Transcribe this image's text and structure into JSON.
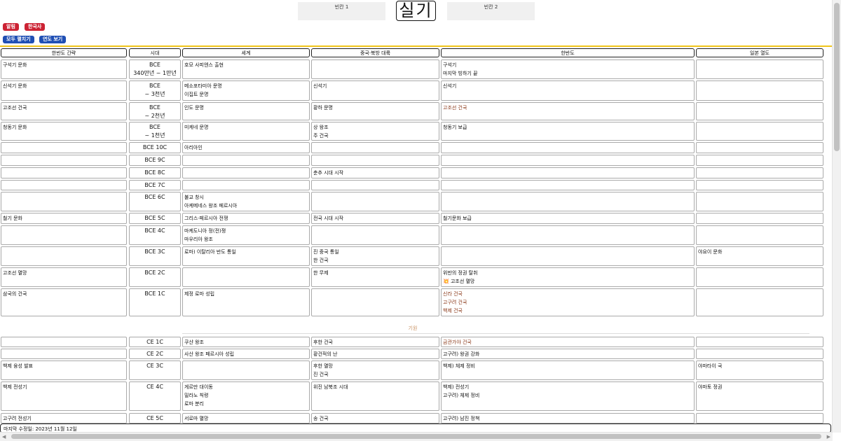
{
  "top": {
    "blank1": "빈칸 1",
    "title": "실기",
    "blank2": "빈칸 2"
  },
  "buttons": {
    "notes": "알림",
    "korean_history": "한국사",
    "collapse_all": "모두 펼치기",
    "year_view": "연도 보기"
  },
  "headers": {
    "peninsula_brief": "한반도 간략",
    "era": "시대",
    "world": "세계",
    "china_north": "중국·북방 대륙",
    "peninsula": "한반도",
    "japan": "일본 열도"
  },
  "rows_bce": [
    {
      "brief": "구석기 문화",
      "era": [
        "BCE",
        "340만년 ~ 1만년"
      ],
      "world": [
        "호모 사피엔스 출현"
      ],
      "china": [],
      "peninsula": [
        "구석기",
        "마지막 빙하기 끝"
      ],
      "japan": []
    },
    {
      "brief": "신석기 문화",
      "era": [
        "BCE",
        "~ 3천년"
      ],
      "world": [
        "메소포타미아 문명",
        "이집트 문명"
      ],
      "china": [
        "신석기"
      ],
      "peninsula": [
        "신석기"
      ],
      "japan": []
    },
    {
      "brief": "고조선 건국",
      "era": [
        "BCE",
        "~ 2천년"
      ],
      "world": [
        "인도 문명"
      ],
      "china": [
        "황하 문명"
      ],
      "peninsula": [
        "고조선 건국"
      ],
      "japan": []
    },
    {
      "brief": "청동기 문화",
      "era": [
        "BCE",
        "~ 1천년"
      ],
      "world": [
        "미케네 문명"
      ],
      "china": [
        "상 왕조",
        "주 건국"
      ],
      "peninsula": [
        "청동기 보급"
      ],
      "japan": []
    },
    {
      "brief": "",
      "era": [
        "BCE 10C"
      ],
      "world": [
        "아리아인"
      ],
      "china": [],
      "peninsula": [],
      "japan": []
    },
    {
      "brief": "",
      "era": [
        "BCE 9C"
      ],
      "world": [],
      "china": [],
      "peninsula": [],
      "japan": []
    },
    {
      "brief": "",
      "era": [
        "BCE 8C"
      ],
      "world": [],
      "china": [
        "춘추 시대 시작"
      ],
      "peninsula": [],
      "japan": []
    },
    {
      "brief": "",
      "era": [
        "BCE 7C"
      ],
      "world": [],
      "china": [],
      "peninsula": [],
      "japan": []
    },
    {
      "brief": "",
      "era": [
        "BCE 6C"
      ],
      "world": [
        "불교 창시",
        "아케메네스 왕조 페르시아"
      ],
      "china": [],
      "peninsula": [],
      "japan": []
    },
    {
      "brief": "철기 문화",
      "era": [
        "BCE 5C"
      ],
      "world": [
        "그리스·페르시아 전쟁"
      ],
      "china": [
        "전국 시대 시작"
      ],
      "peninsula": [
        "철기문화 보급"
      ],
      "japan": []
    },
    {
      "brief": "",
      "era": [
        "BCE 4C"
      ],
      "world": [
        "마케도니아 정(전)쟁",
        "마우리아 왕조"
      ],
      "china": [],
      "peninsula": [],
      "japan": []
    },
    {
      "brief": "",
      "era": [
        "BCE 3C"
      ],
      "world": [
        "로마) 이탈리아 반도 통일"
      ],
      "china": [
        "진 중국 통일",
        "한 건국"
      ],
      "peninsula": [],
      "japan": [
        "야요이 문화"
      ]
    },
    {
      "brief": "고조선 멸망",
      "era": [
        "BCE 2C"
      ],
      "world": [],
      "china": [
        "한 무제"
      ],
      "peninsula": [
        "위만의 정권 탈취",
        "💥 고조선 멸망"
      ],
      "japan": []
    },
    {
      "brief": "삼국의 건국",
      "era": [
        "BCE 1C"
      ],
      "world": [
        "제정 로마 성립"
      ],
      "china": [],
      "peninsula": [
        "신라 건국",
        "고구려 건국",
        "백제 건국"
      ],
      "japan": []
    }
  ],
  "divider_label": "기원",
  "rows_ce": [
    {
      "brief": "",
      "era": [
        "CE 1C"
      ],
      "world": [
        "쿠샨 왕조"
      ],
      "china": [
        "후한 건국"
      ],
      "peninsula": [
        "금관가야 건국"
      ],
      "japan": []
    },
    {
      "brief": "",
      "era": [
        "CE 2C"
      ],
      "world": [
        "사산 왕조 페르시아 성립"
      ],
      "china": [
        "황건적의 난"
      ],
      "peninsula": [
        "고구려) 왕권 강화"
      ],
      "japan": []
    },
    {
      "brief": "백제 융성 발표",
      "era": [
        "CE 3C"
      ],
      "world": [],
      "china": [
        "후한 멸망",
        "진 건국"
      ],
      "peninsula": [
        "백제) 체제 정비"
      ],
      "japan": [
        "야마타이 국"
      ]
    },
    {
      "brief": "백제 전성기",
      "era": [
        "CE 4C"
      ],
      "world": [
        "게르만 대이동",
        "밀라노 칙령",
        "로마 분리"
      ],
      "china": [
        "위진 남북조 시대"
      ],
      "peninsula": [
        "백제) 전성기",
        "고구려) 체제 정비"
      ],
      "japan": [
        "야마토 정권"
      ]
    },
    {
      "brief": "고구려 전성기",
      "era": [
        "CE 5C"
      ],
      "world": [
        "서로마 멸망"
      ],
      "china": [
        "송 건국"
      ],
      "peninsula": [
        "고구려) 남진 정책"
      ],
      "japan": []
    }
  ],
  "footer": "마지막 수정일: 2023년 11월 12일"
}
